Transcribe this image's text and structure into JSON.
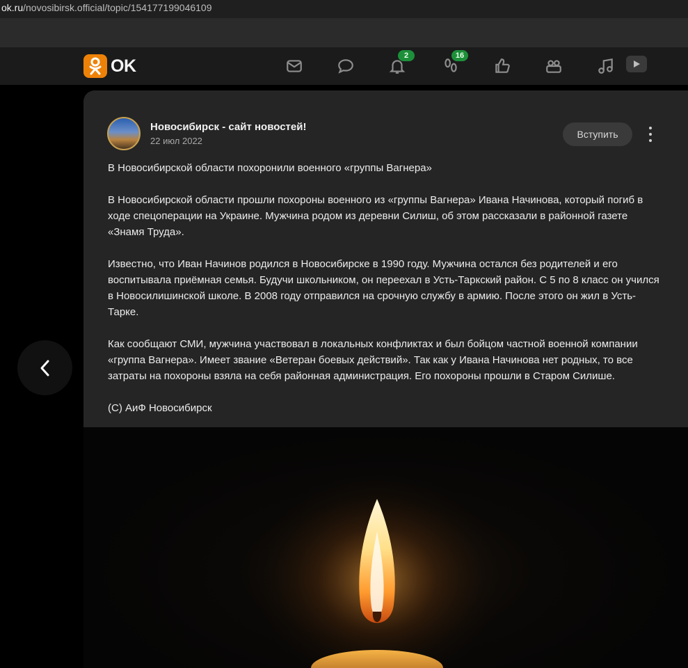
{
  "browser": {
    "url_host": "ok.ru",
    "url_path": "/novosibirsk.official/topic/154177199046109"
  },
  "nav": {
    "logo_text": "OK",
    "icons": [
      "messages-icon",
      "discussions-icon",
      "notifications-icon",
      "guests-icon",
      "likes-icon",
      "friends-icon",
      "music-icon",
      "video-icon"
    ],
    "notifications_count": "2",
    "guests_count": "16"
  },
  "post": {
    "group_name": "Новосибирск - сайт новостей!",
    "date": "22 июл 2022",
    "join_label": "Вступить",
    "paragraphs": [
      "В Новосибирской области похоронили военного «группы Вагнера»",
      "В Новосибирской области прошли похороны военного из «группы Вагнера» Ивана Начинова, который погиб в ходе спецоперации на Украине. Мужчина родом из деревни Силиш, об этом рассказали в районной газете «Знамя Труда».",
      "Известно, что Иван Начинов родился в Новосибирске в 1990 году. Мужчина остался без родителей и его воспитывала приёмная семья. Будучи школьником, он переехал в Усть-Таркский район. С 5 по 8 класс он учился в Новосилишинской школе. В 2008 году отправился на срочную службу в армию. После этого он жил в Усть-Тарке.",
      "Как сообщают СМИ, мужчина участвовал в локальных конфликтах и был бойцом частной военной компании «группа Вагнера». Имеет звание «Ветеран боевых действий». Так как у Ивана Начинова нет родных, то все затраты на похороны взяла на себя районная администрация. Его похороны прошли в Старом Силише.",
      "(C) АиФ Новосибирск"
    ]
  },
  "colors": {
    "brand": "#ee8208",
    "badge": "#1d8f3a",
    "card": "#252525"
  }
}
